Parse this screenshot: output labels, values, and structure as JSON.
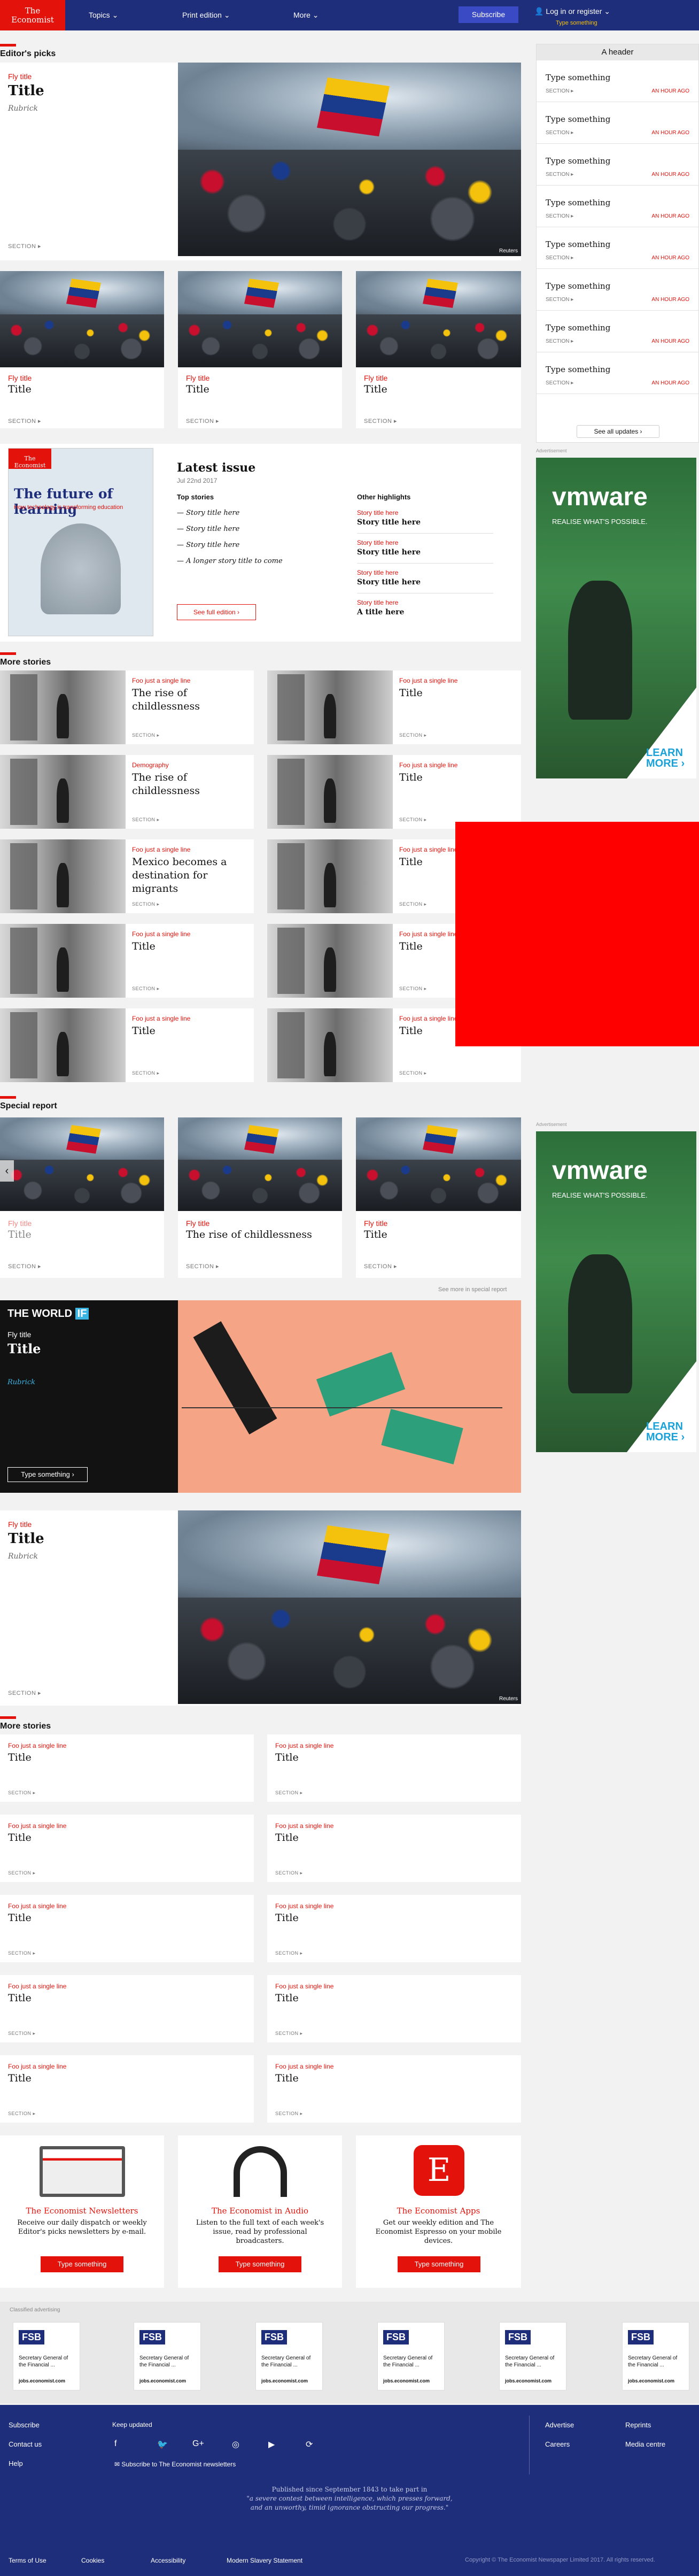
{
  "nav": {
    "logo_line1": "The",
    "logo_line2": "Economist",
    "topics": "Topics",
    "print_edition": "Print edition",
    "more": "More",
    "subscribe": "Subscribe",
    "login": "Log in or register",
    "login_sub": "Type something"
  },
  "editors_picks": {
    "heading": "Editor's picks",
    "lead": {
      "fly": "Fly title",
      "title": "Title",
      "byline": "Rubrick",
      "section": "SECTION ▸",
      "credit": "Reuters"
    },
    "cards": [
      {
        "fly": "Fly title",
        "title": "Title",
        "section": "SECTION ▸"
      },
      {
        "fly": "Fly title",
        "title": "Title",
        "section": "SECTION ▸"
      },
      {
        "fly": "Fly title",
        "title": "Title",
        "section": "SECTION ▸"
      }
    ]
  },
  "updates": {
    "header": "A header",
    "items": [
      {
        "title": "Type something",
        "section": "SECTION ▸",
        "time": "AN HOUR AGO"
      },
      {
        "title": "Type something",
        "section": "SECTION ▸",
        "time": "AN HOUR AGO"
      },
      {
        "title": "Type something",
        "section": "SECTION ▸",
        "time": "AN HOUR AGO"
      },
      {
        "title": "Type something",
        "section": "SECTION ▸",
        "time": "AN HOUR AGO"
      },
      {
        "title": "Type something",
        "section": "SECTION ▸",
        "time": "AN HOUR AGO"
      },
      {
        "title": "Type something",
        "section": "SECTION ▸",
        "time": "AN HOUR AGO"
      },
      {
        "title": "Type something",
        "section": "SECTION ▸",
        "time": "AN HOUR AGO"
      },
      {
        "title": "Type something",
        "section": "SECTION ▸",
        "time": "AN HOUR AGO"
      }
    ],
    "see_all": "See all updates ›"
  },
  "latest_issue": {
    "cover_brand": "The Economist",
    "cover_title": "The future of learning",
    "cover_sub": "How technology is transforming education",
    "title": "Latest issue",
    "date": "Jul 22nd 2017",
    "top_stories_heading": "Top stories",
    "top_stories": [
      "— Story title here",
      "— Story title here",
      "— Story title here",
      "— A longer story title to come"
    ],
    "other_heading": "Other highlights",
    "highlights": [
      {
        "fly": "Story title here",
        "title": "Story title here"
      },
      {
        "fly": "Story title here",
        "title": "Story title here"
      },
      {
        "fly": "Story title here",
        "title": "Story title here"
      },
      {
        "fly": "Story title here",
        "title": "A title here"
      }
    ],
    "full_edition": "See full edition ›"
  },
  "advert_label": "Advertisement",
  "ad_vmware": {
    "brand": "vmware",
    "tag": "REALISE WHAT'S POSSIBLE.",
    "cta_1": "LEARN",
    "cta_2": "MORE ›"
  },
  "more_stories": {
    "heading": "More stories",
    "rows": [
      [
        {
          "fly": "Foo just a single line",
          "title": "The rise of childlessness",
          "section": "SECTION ▸"
        },
        {
          "fly": "Foo just a single line",
          "title": "Title",
          "section": "SECTION ▸"
        }
      ],
      [
        {
          "fly": "Demography",
          "title": "The rise of childlessness",
          "section": "SECTION ▸"
        },
        {
          "fly": "Foo just a single line",
          "title": "Title",
          "section": "SECTION ▸"
        }
      ],
      [
        {
          "fly": "Foo just a single line",
          "title": "Mexico becomes a destination for migrants",
          "section": "SECTION ▸"
        },
        {
          "fly": "Foo just a single line",
          "title": "Title",
          "section": "SECTION ▸"
        }
      ],
      [
        {
          "fly": "Foo just a single line",
          "title": "Title",
          "section": "SECTION ▸"
        },
        {
          "fly": "Foo just a single line",
          "title": "Title",
          "section": "SECTION ▸"
        }
      ],
      [
        {
          "fly": "Foo just a single line",
          "title": "Title",
          "section": "SECTION ▸"
        },
        {
          "fly": "Foo just a single line",
          "title": "Title",
          "section": "SECTION ▸"
        }
      ]
    ]
  },
  "special_report": {
    "heading": "Special report",
    "cards": [
      {
        "fly": "Fly title",
        "title": "Title",
        "section": "SECTION ▸"
      },
      {
        "fly": "Fly title",
        "title": "The rise of childlessness",
        "section": "SECTION ▸"
      },
      {
        "fly": "Fly title",
        "title": "Title",
        "section": "SECTION ▸"
      }
    ],
    "see_more": "See more in special report"
  },
  "world_if": {
    "brand": "THE WORLD",
    "brand_if": "IF",
    "fly": "Fly title",
    "title": "Title",
    "byline": "Rubrick",
    "button": "Type something ›"
  },
  "feature": {
    "fly": "Fly title",
    "title": "Title",
    "byline": "Rubrick",
    "section": "SECTION ▸",
    "credit": "Reuters"
  },
  "more_stories2": {
    "heading": "More stories",
    "items": [
      {
        "fly": "Foo just a single line",
        "title": "Title",
        "section": "SECTION ▸"
      },
      {
        "fly": "Foo just a single line",
        "title": "Title",
        "section": "SECTION ▸"
      },
      {
        "fly": "Foo just a single line",
        "title": "Title",
        "section": "SECTION ▸"
      },
      {
        "fly": "Foo just a single line",
        "title": "Title",
        "section": "SECTION ▸"
      },
      {
        "fly": "Foo just a single line",
        "title": "Title",
        "section": "SECTION ▸"
      },
      {
        "fly": "Foo just a single line",
        "title": "Title",
        "section": "SECTION ▸"
      },
      {
        "fly": "Foo just a single line",
        "title": "Title",
        "section": "SECTION ▸"
      },
      {
        "fly": "Foo just a single line",
        "title": "Title",
        "section": "SECTION ▸"
      },
      {
        "fly": "Foo just a single line",
        "title": "Title",
        "section": "SECTION ▸"
      },
      {
        "fly": "Foo just a single line",
        "title": "Title",
        "section": "SECTION ▸"
      }
    ]
  },
  "promos": [
    {
      "title": "The Economist Newsletters",
      "desc": "Receive our daily dispatch or weekly Editor's picks newsletters by e-mail.",
      "button": "Type something"
    },
    {
      "title": "The Economist in Audio",
      "desc": "Listen to the full text of each week's issue, read by professional broadcasters.",
      "button": "Type something"
    },
    {
      "title": "The Economist Apps",
      "desc": "Get our weekly edition and The Economist Espresso on your mobile devices.",
      "button": "Type something"
    }
  ],
  "classified": {
    "label": "Classified advertising",
    "items": [
      {
        "logo": "FSB",
        "role": "Secretary General of the Financial ...",
        "site": "jobs.economist.com"
      },
      {
        "logo": "FSB",
        "role": "Secretary General of the Financial ...",
        "site": "jobs.economist.com"
      },
      {
        "logo": "FSB",
        "role": "Secretary General of the Financial ...",
        "site": "jobs.economist.com"
      },
      {
        "logo": "FSB",
        "role": "Secretary General of the Financial ...",
        "site": "jobs.economist.com"
      },
      {
        "logo": "FSB",
        "role": "Secretary General of the Financial ...",
        "site": "jobs.economist.com"
      },
      {
        "logo": "FSB",
        "role": "Secretary General of the Financial ...",
        "site": "jobs.economist.com"
      }
    ]
  },
  "footer": {
    "col1": [
      "Subscribe",
      "Contact us",
      "Help"
    ],
    "keep_updated": "Keep updated",
    "newsletter": "Subscribe to The Economist newsletters",
    "col3": [
      "Advertise",
      "Careers"
    ],
    "col4": [
      "Reprints",
      "Media centre"
    ],
    "quote_1": "Published since September 1843 to take part in",
    "quote_2": "\"a severe contest between intelligence, which presses forward,",
    "quote_3": "and an unworthy, timid ignorance obstructing our progress.\"",
    "bottom": [
      "Terms of Use",
      "Cookies",
      "Accessibility",
      "Modern Slavery Statement"
    ],
    "copyright": "Copyright © The Economist Newspaper Limited 2017. All rights reserved."
  }
}
